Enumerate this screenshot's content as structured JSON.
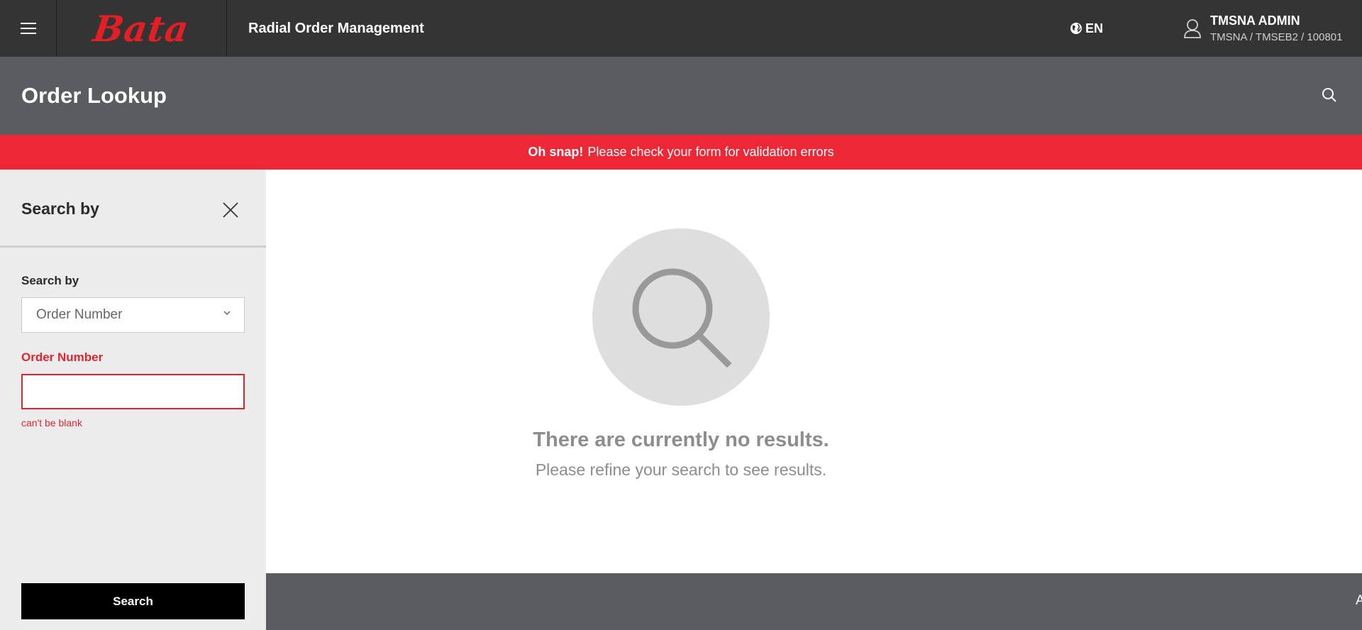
{
  "topbar": {
    "menu_icon": "hamburger-icon",
    "brand": "Bata",
    "app_title": "Radial Order Management",
    "language": "EN",
    "language_icon": "globe-icon",
    "user_icon": "user-icon",
    "user_name": "TMSNA ADMIN",
    "user_org": "TMSNA / TMSEB2 / 100801"
  },
  "page": {
    "title": "Order Lookup",
    "search_icon": "search-icon"
  },
  "alert": {
    "strong": "Oh snap!",
    "message": "Please check your form for validation errors",
    "color": "#ee2737"
  },
  "sidebar": {
    "title": "Search by",
    "close_icon": "close-icon",
    "search_by_label": "Search by",
    "search_by_value": "Order Number",
    "order_number_label": "Order Number",
    "order_number_value": "",
    "order_number_error": "can't be blank",
    "search_button": "Search"
  },
  "empty_state": {
    "icon": "search-icon",
    "title": "There are currently no results.",
    "subtitle": "Please refine your search to see results."
  },
  "footer": {
    "text": "A"
  },
  "colors": {
    "topbar": "#343434",
    "header": "#5b5b62",
    "brand_red": "#e31e24",
    "error_red": "#e1252f"
  }
}
